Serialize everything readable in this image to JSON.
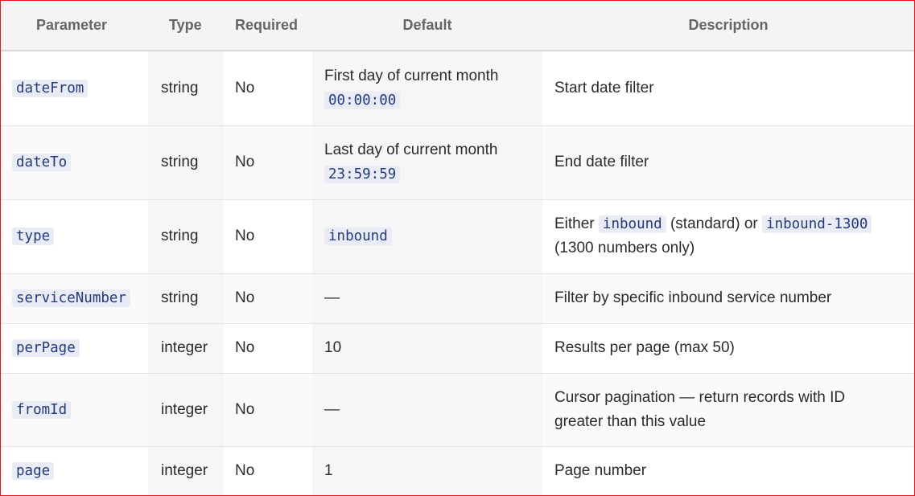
{
  "table": {
    "headers": {
      "parameter": "Parameter",
      "type": "Type",
      "required": "Required",
      "default": "Default",
      "description": "Description"
    },
    "rows": [
      {
        "param": "dateFrom",
        "type": "string",
        "required": "No",
        "default_text": "First day of current month",
        "default_code": "00:00:00",
        "description": "Start date filter"
      },
      {
        "param": "dateTo",
        "type": "string",
        "required": "No",
        "default_text": "Last day of current month",
        "default_code": "23:59:59",
        "description": "End date filter"
      },
      {
        "param": "type",
        "type": "string",
        "required": "No",
        "default_code": "inbound",
        "desc_before": "Either",
        "desc_code1": "inbound",
        "desc_mid": "(standard) or",
        "desc_code2": "inbound-1300",
        "desc_after": "(1300 numbers only)"
      },
      {
        "param": "serviceNumber",
        "type": "string",
        "required": "No",
        "default_text": "—",
        "description": "Filter by specific inbound service number"
      },
      {
        "param": "perPage",
        "type": "integer",
        "required": "No",
        "default_text": "10",
        "description": "Results per page (max 50)"
      },
      {
        "param": "fromId",
        "type": "integer",
        "required": "No",
        "default_text": "—",
        "description_line1": "Cursor pagination — return records with ID",
        "description_line2": "greater than this value"
      },
      {
        "param": "page",
        "type": "integer",
        "required": "No",
        "default_text": "1",
        "description": "Page number"
      }
    ]
  },
  "colors": {
    "border_accent": "#e8161c",
    "code_text": "#243a7a",
    "code_background": "#e9ecf5",
    "header_background": "#f4f4f4"
  }
}
